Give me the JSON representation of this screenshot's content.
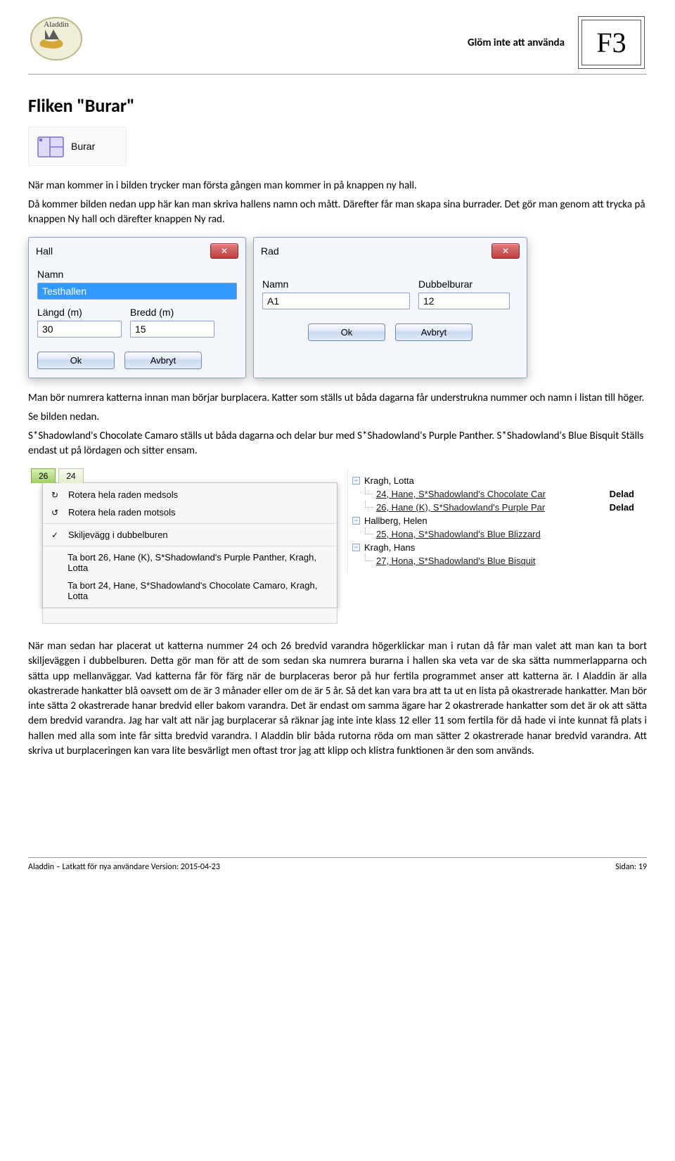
{
  "header": {
    "hint": "Glöm inte att använda",
    "shortcut": "F3"
  },
  "title": "Fliken \"Burar\"",
  "burar_tab_label": "Burar",
  "intro": {
    "p1": "När man kommer in i bilden trycker man första gången man kommer in på knappen ny hall.",
    "p2": "Då kommer bilden nedan upp här kan man skriva hallens namn och mått. Därefter får man skapa sina burrader. Det gör man genom att trycka på knappen Ny hall och därefter knappen Ny rad."
  },
  "dialog_hall": {
    "title": "Hall",
    "namn_label": "Namn",
    "namn_value": "Testhallen",
    "langd_label": "Längd (m)",
    "langd_value": "30",
    "bredd_label": "Bredd (m)",
    "bredd_value": "15",
    "ok": "Ok",
    "avbryt": "Avbryt"
  },
  "dialog_rad": {
    "title": "Rad",
    "namn_label": "Namn",
    "namn_value": "A1",
    "dubbel_label": "Dubbelburar",
    "dubbel_value": "12",
    "ok": "Ok",
    "avbryt": "Avbryt"
  },
  "mid": {
    "p1": "Man bör numrera katterna innan man börjar burplacera. Katter som ställs ut båda dagarna får understrukna nummer och namn i listan till höger.",
    "p2": "Se bilden nedan.",
    "p3": "S*Shadowland's Chocolate Camaro ställs ut båda dagarna och delar bur med S*Shadowland's Purple Panther. S*Shadowland's Blue Bisquit Ställs endast ut på lördagen och sitter ensam."
  },
  "tabs": {
    "t1": "26",
    "t2": "24"
  },
  "ctx": {
    "i1": "Rotera hela raden medsols",
    "i2": "Rotera hela raden motsols",
    "i3": "Skiljevägg i dubbelburen",
    "i4": "Ta bort 26, Hane (K), S*Shadowland's Purple Panther, Kragh, Lotta",
    "i5": "Ta bort 24, Hane, S*Shadowland's Chocolate Camaro, Kragh, Lotta"
  },
  "tree": {
    "o1": "Kragh, Lotta",
    "o1c1": "24, Hane, S*Shadowland's Chocolate Car",
    "o1c2": "26, Hane (K), S*Shadowland's Purple Par",
    "o2": "Hallberg, Helen",
    "o2c1": "25, Hona, S*Shadowland's Blue Blizzard",
    "o3": "Kragh, Hans",
    "o3c1": "27, Hona, S*Shadowland's Blue Bisquit",
    "delad": "Delad"
  },
  "long": "När man sedan har placerat ut katterna nummer 24 och 26 bredvid varandra högerklickar man i rutan då får man valet att man kan ta bort skiljeväggen i dubbelburen. Detta gör man för att de som sedan ska numrera burarna i hallen ska veta var de ska sätta nummerlapparna och sätta upp mellanväggar. Vad katterna får för färg när de burplaceras beror på hur fertila programmet anser att katterna är. I Aladdin är alla okastrerade hankatter blå oavsett om de är 3 månader eller om de är 5 år. Så det kan vara bra att ta ut en lista på okastrerade hankatter. Man bör inte sätta 2 okastrerade hanar bredvid eller bakom varandra. Det är endast om samma ägare har 2 okastrerade hankatter som det är ok att sätta dem bredvid varandra. Jag har valt att när jag burplacerar så räknar jag inte inte klass 12 eller 11 som fertila för då hade vi inte kunnat få plats i hallen med alla som inte får sitta bredvid varandra. I Aladdin blir båda rutorna röda om man sätter 2 okastrerade hanar bredvid varandra.  Att skriva ut burplaceringen kan vara lite besvärligt men oftast tror jag att klipp och klistra funktionen är den som används.",
  "footer": {
    "left": "Aladdin – Latkatt för nya användare Version: 2015-04-23",
    "right": "Sidan: 19"
  }
}
